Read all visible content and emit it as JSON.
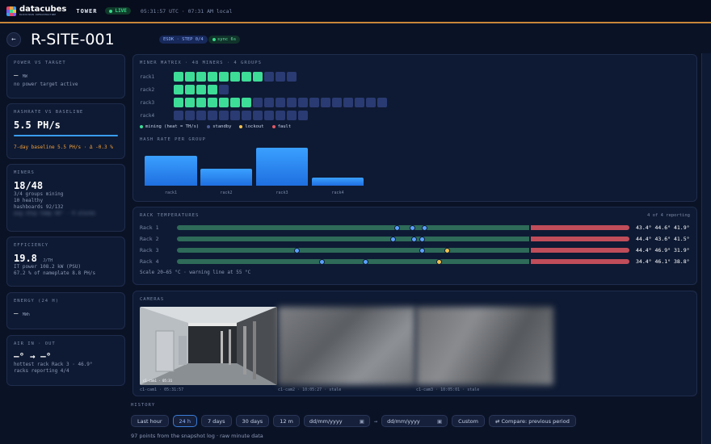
{
  "topbar": {
    "brand": "datacubes",
    "brand_sub": "BLOCKCHAIN INFRASTRUCTURE",
    "site": "TOWER",
    "live": "LIVE",
    "clock": "05:31:57 UTC · 07:31 AM local"
  },
  "header": {
    "title": "R-SITE-001",
    "badge_step": "ESDK · STEP 0/4",
    "badge_sync": "sync 6s"
  },
  "power": {
    "title": "POWER VS TARGET",
    "value": "—",
    "unit": "MW",
    "note": "no power target active"
  },
  "hashrate": {
    "title": "HASHRATE VS BASELINE",
    "value": "5.5 PH/s",
    "baseline": "7-day baseline 5.5 PH/s · Δ -0.3 %"
  },
  "miners": {
    "title": "MINERS",
    "value": "18/48",
    "l1": "3/4 groups mining",
    "l2": "10 healthy",
    "l3": "hashboards 92/132",
    "l4": "avg chip temp 44° · 0 alarms"
  },
  "efficiency": {
    "title": "EFFICIENCY",
    "value": "19.8",
    "unit": "J/TH",
    "l1": "IT power 108.2 kW (PSU)",
    "l2": "67.2 % of nameplate 8.8 PH/s"
  },
  "energy": {
    "title": "ENERGY (24 H)",
    "value": "—",
    "unit": "MWh"
  },
  "air": {
    "title": "AIR IN · OUT",
    "value": "—° → —°",
    "l1": "hottest rack Rack 3 · 46.9°",
    "l2": "racks reporting 4/4"
  },
  "matrix": {
    "title": "MINER MATRIX · 48 MINERS · 4 GROUPS",
    "rows": [
      {
        "label": "rack1",
        "on": 8,
        "off": 3
      },
      {
        "label": "rack2",
        "on": 4,
        "off": 1
      },
      {
        "label": "rack3",
        "on": 7,
        "off": 12
      },
      {
        "label": "rack4",
        "on": 0,
        "off": 12
      }
    ],
    "legend": [
      {
        "label": "mining (heat = TH/s)",
        "color": "#3ddc97"
      },
      {
        "label": "standby",
        "color": "#4a5a90"
      },
      {
        "label": "lockout",
        "color": "#f2c14e"
      },
      {
        "label": "fault",
        "color": "#e05a66"
      }
    ],
    "bars_title": "HASH RATE PER GROUP"
  },
  "chart_data": {
    "type": "bar",
    "categories": [
      "rack1",
      "rack2",
      "rack3",
      "rack4"
    ],
    "values": [
      1.9,
      1.05,
      2.4,
      0.5
    ],
    "title": "HASH RATE PER GROUP"
  },
  "temps": {
    "title": "RACK TEMPERATURES",
    "reporting": "4 of 4 reporting",
    "scale": "Scale 20–65 °C · warning line at 55 °C",
    "rows": [
      {
        "label": "Rack 1",
        "vals": "43.4° 44.6° 41.9°",
        "points": [
          {
            "t": 43.4,
            "c": "#5aa0ff"
          },
          {
            "t": 44.6,
            "c": "#5aa0ff"
          },
          {
            "t": 41.9,
            "c": "#5aa0ff"
          }
        ]
      },
      {
        "label": "Rack 2",
        "vals": "44.4° 43.6° 41.5°",
        "points": [
          {
            "t": 44.4,
            "c": "#5aa0ff"
          },
          {
            "t": 43.6,
            "c": "#5aa0ff"
          },
          {
            "t": 41.5,
            "c": "#5aa0ff"
          }
        ]
      },
      {
        "label": "Rack 3",
        "vals": "44.4° 46.9° 31.9°",
        "points": [
          {
            "t": 44.4,
            "c": "#5aa0ff"
          },
          {
            "t": 46.9,
            "c": "#f2c14e"
          },
          {
            "t": 31.9,
            "c": "#5aa0ff"
          }
        ]
      },
      {
        "label": "Rack 4",
        "vals": "34.4° 46.1° 38.8°",
        "points": [
          {
            "t": 34.4,
            "c": "#5aa0ff"
          },
          {
            "t": 46.1,
            "c": "#f2c14e"
          },
          {
            "t": 38.8,
            "c": "#5aa0ff"
          }
        ]
      }
    ]
  },
  "cameras": {
    "title": "CAMERAS",
    "items": [
      {
        "cap": "c1-cam1 · 05:31:57",
        "stamp": "c1-cam1 · 05:31"
      },
      {
        "cap": "c1-cam2 · 10:05:27 · stale"
      },
      {
        "cap": "c1-cam3 · 10:05:01 · stale"
      }
    ]
  },
  "history": {
    "title": "HISTORY",
    "buttons": [
      "Last hour",
      "24 h",
      "7 days",
      "30 days",
      "12 m"
    ],
    "active": "24 h",
    "date_placeholder": "dd/mm/yyyy",
    "custom": "Custom",
    "compare": "⇄ Compare: previous period",
    "note": "97 points from the snapshot log · raw minute data"
  }
}
